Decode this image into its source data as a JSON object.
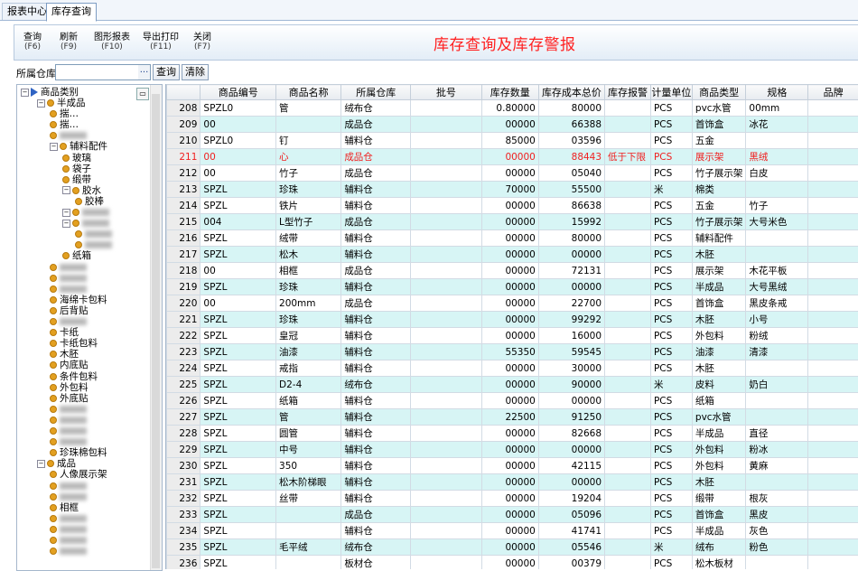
{
  "tabs": [
    "报表中心",
    "库存查询"
  ],
  "toolbar": {
    "buttons": [
      {
        "label": "查询",
        "key": "(F6)"
      },
      {
        "label": "刷新",
        "key": "(F9)"
      },
      {
        "label": "图形报表",
        "key": "(F10)"
      },
      {
        "label": "导出打印",
        "key": "(F11)"
      },
      {
        "label": "关闭",
        "key": "(F7)"
      }
    ],
    "banner": "库存查询及库存警报"
  },
  "filter": {
    "label": "所属仓库:",
    "value": "",
    "dots": "...",
    "query": "查询",
    "clear": "清除"
  },
  "tree": {
    "root": "商品类别",
    "items": [
      {
        "t": "半成品",
        "lv": 1,
        "k": "m"
      },
      {
        "t": "揣…",
        "lv": 2,
        "k": "n"
      },
      {
        "t": "揣…",
        "lv": 2,
        "k": "n"
      },
      {
        "t": "",
        "lv": 2,
        "k": "n"
      },
      {
        "t": "辅料配件",
        "lv": 2,
        "k": "m"
      },
      {
        "t": "玻璃",
        "lv": 3,
        "k": "n"
      },
      {
        "t": "袋子",
        "lv": 3,
        "k": "n"
      },
      {
        "t": "缎带",
        "lv": 3,
        "k": "n"
      },
      {
        "t": "胶水",
        "lv": 3,
        "k": "m"
      },
      {
        "t": "胶棒",
        "lv": 4,
        "k": "n"
      },
      {
        "t": "",
        "lv": 3,
        "k": "m"
      },
      {
        "t": "",
        "lv": 3,
        "k": "m"
      },
      {
        "t": "",
        "lv": 4,
        "k": "n"
      },
      {
        "t": "",
        "lv": 4,
        "k": "n"
      },
      {
        "t": "纸箱",
        "lv": 3,
        "k": "n"
      },
      {
        "t": "",
        "lv": 2,
        "k": "n"
      },
      {
        "t": "",
        "lv": 2,
        "k": "n"
      },
      {
        "t": "",
        "lv": 2,
        "k": "n"
      },
      {
        "t": "海绵卡包料",
        "lv": 2,
        "k": "n"
      },
      {
        "t": "后背贴",
        "lv": 2,
        "k": "n"
      },
      {
        "t": "",
        "lv": 2,
        "k": "n"
      },
      {
        "t": "卡纸",
        "lv": 2,
        "k": "n"
      },
      {
        "t": "卡纸包料",
        "lv": 2,
        "k": "n"
      },
      {
        "t": "木胚",
        "lv": 2,
        "k": "n"
      },
      {
        "t": "内底贴",
        "lv": 2,
        "k": "n"
      },
      {
        "t": "条件包料",
        "lv": 2,
        "k": "n"
      },
      {
        "t": "外包料",
        "lv": 2,
        "k": "n"
      },
      {
        "t": "外底贴",
        "lv": 2,
        "k": "n"
      },
      {
        "t": "",
        "lv": 2,
        "k": "n"
      },
      {
        "t": "",
        "lv": 2,
        "k": "n"
      },
      {
        "t": "",
        "lv": 2,
        "k": "n"
      },
      {
        "t": "",
        "lv": 2,
        "k": "n"
      },
      {
        "t": "珍珠棉包料",
        "lv": 2,
        "k": "n"
      },
      {
        "t": "成品",
        "lv": 1,
        "k": "m"
      },
      {
        "t": "人像展示架",
        "lv": 2,
        "k": "n"
      },
      {
        "t": "",
        "lv": 2,
        "k": "n"
      },
      {
        "t": "",
        "lv": 2,
        "k": "n"
      },
      {
        "t": "相框",
        "lv": 2,
        "k": "n"
      },
      {
        "t": "",
        "lv": 2,
        "k": "n"
      },
      {
        "t": "",
        "lv": 2,
        "k": "n"
      },
      {
        "t": "",
        "lv": 2,
        "k": "n"
      },
      {
        "t": "",
        "lv": 2,
        "k": "n"
      }
    ]
  },
  "grid": {
    "headers": [
      "",
      "商品编号",
      "商品名称",
      "所属仓库",
      "批号",
      "库存数量",
      "库存成本总价",
      "库存报警",
      "计量单位",
      "商品类型",
      "规格",
      "品牌"
    ],
    "rows": [
      {
        "n": "208",
        "c": "SPZL0",
        "nm": "管",
        "w": "绒布仓",
        "q": "0.80000",
        "cost": "80000",
        "a": "",
        "u": "PCS",
        "t": "pvc水管",
        "s": "00mm"
      },
      {
        "n": "209",
        "c": "00",
        "nm": "",
        "w": "成品仓",
        "q": "00000",
        "cost": "66388",
        "a": "",
        "u": "PCS",
        "t": "首饰盒",
        "s": "冰花"
      },
      {
        "n": "210",
        "c": "SPZL0",
        "nm": "钉",
        "w": "辅料仓",
        "q": "85000",
        "cost": "03596",
        "a": "",
        "u": "PCS",
        "t": "五金",
        "s": ""
      },
      {
        "n": "211",
        "c": "00",
        "nm": "心",
        "w": "成品仓",
        "q": "00000",
        "cost": "88443",
        "a": "低于下限",
        "u": "PCS",
        "t": "展示架",
        "s": "黑绒"
      },
      {
        "n": "212",
        "c": "00",
        "nm": "竹子",
        "w": "成品仓",
        "q": "00000",
        "cost": "05040",
        "a": "",
        "u": "PCS",
        "t": "竹子展示架",
        "s": "白皮"
      },
      {
        "n": "213",
        "c": "SPZL",
        "nm": "珍珠",
        "w": "辅料仓",
        "q": "70000",
        "cost": "55500",
        "a": "",
        "u": "米",
        "t": "棉类",
        "s": ""
      },
      {
        "n": "214",
        "c": "SPZL",
        "nm": "铁片",
        "w": "辅料仓",
        "q": "00000",
        "cost": "86638",
        "a": "",
        "u": "PCS",
        "t": "五金",
        "s": "竹子"
      },
      {
        "n": "215",
        "c": "004",
        "nm": "L型竹子",
        "w": "成品仓",
        "q": "00000",
        "cost": "15992",
        "a": "",
        "u": "PCS",
        "t": "竹子展示架",
        "s": "大号米色"
      },
      {
        "n": "216",
        "c": "SPZL",
        "nm": "绒带",
        "w": "辅料仓",
        "q": "00000",
        "cost": "80000",
        "a": "",
        "u": "PCS",
        "t": "辅料配件",
        "s": ""
      },
      {
        "n": "217",
        "c": "SPZL",
        "nm": "松木",
        "w": "辅料仓",
        "q": "00000",
        "cost": "00000",
        "a": "",
        "u": "PCS",
        "t": "木胚",
        "s": ""
      },
      {
        "n": "218",
        "c": "00",
        "nm": "相框",
        "w": "成品仓",
        "q": "00000",
        "cost": "72131",
        "a": "",
        "u": "PCS",
        "t": "展示架",
        "s": "木花平板"
      },
      {
        "n": "219",
        "c": "SPZL",
        "nm": "珍珠",
        "w": "辅料仓",
        "q": "00000",
        "cost": "00000",
        "a": "",
        "u": "PCS",
        "t": "半成品",
        "s": "大号黑绒"
      },
      {
        "n": "220",
        "c": "00",
        "nm": "200mm",
        "w": "成品仓",
        "q": "00000",
        "cost": "22700",
        "a": "",
        "u": "PCS",
        "t": "首饰盒",
        "s": "黑皮条戒"
      },
      {
        "n": "221",
        "c": "SPZL",
        "nm": "珍珠",
        "w": "辅料仓",
        "q": "00000",
        "cost": "99292",
        "a": "",
        "u": "PCS",
        "t": "木胚",
        "s": "小号"
      },
      {
        "n": "222",
        "c": "SPZL",
        "nm": "皇冠",
        "w": "辅料仓",
        "q": "00000",
        "cost": "16000",
        "a": "",
        "u": "PCS",
        "t": "外包料",
        "s": "粉绒"
      },
      {
        "n": "223",
        "c": "SPZL",
        "nm": "油漆",
        "w": "辅料仓",
        "q": "55350",
        "cost": "59545",
        "a": "",
        "u": "PCS",
        "t": "油漆",
        "s": "清漆"
      },
      {
        "n": "224",
        "c": "SPZL",
        "nm": "戒指",
        "w": "辅料仓",
        "q": "00000",
        "cost": "30000",
        "a": "",
        "u": "PCS",
        "t": "木胚",
        "s": ""
      },
      {
        "n": "225",
        "c": "SPZL",
        "nm": "D2-4",
        "w": "绒布仓",
        "q": "00000",
        "cost": "90000",
        "a": "",
        "u": "米",
        "t": "皮料",
        "s": "奶白"
      },
      {
        "n": "226",
        "c": "SPZL",
        "nm": "纸箱",
        "w": "辅料仓",
        "q": "00000",
        "cost": "00000",
        "a": "",
        "u": "PCS",
        "t": "纸箱",
        "s": ""
      },
      {
        "n": "227",
        "c": "SPZL",
        "nm": "管",
        "w": "辅料仓",
        "q": "22500",
        "cost": "91250",
        "a": "",
        "u": "PCS",
        "t": "pvc水管",
        "s": ""
      },
      {
        "n": "228",
        "c": "SPZL",
        "nm": "圆管",
        "w": "辅料仓",
        "q": "00000",
        "cost": "82668",
        "a": "",
        "u": "PCS",
        "t": "半成品",
        "s": "直径"
      },
      {
        "n": "229",
        "c": "SPZL",
        "nm": "中号",
        "w": "辅料仓",
        "q": "00000",
        "cost": "00000",
        "a": "",
        "u": "PCS",
        "t": "外包料",
        "s": "粉冰"
      },
      {
        "n": "230",
        "c": "SPZL",
        "nm": "350",
        "w": "辅料仓",
        "q": "00000",
        "cost": "42115",
        "a": "",
        "u": "PCS",
        "t": "外包料",
        "s": "黄麻"
      },
      {
        "n": "231",
        "c": "SPZL",
        "nm": "松木阶梯眼",
        "w": "辅料仓",
        "q": "00000",
        "cost": "00000",
        "a": "",
        "u": "PCS",
        "t": "木胚",
        "s": ""
      },
      {
        "n": "232",
        "c": "SPZL",
        "nm": "丝带",
        "w": "辅料仓",
        "q": "00000",
        "cost": "19204",
        "a": "",
        "u": "PCS",
        "t": "缎带",
        "s": "根灰"
      },
      {
        "n": "233",
        "c": "SPZL",
        "nm": "",
        "w": "成品仓",
        "q": "00000",
        "cost": "05096",
        "a": "",
        "u": "PCS",
        "t": "首饰盒",
        "s": "黑皮"
      },
      {
        "n": "234",
        "c": "SPZL",
        "nm": "",
        "w": "辅料仓",
        "q": "00000",
        "cost": "41741",
        "a": "",
        "u": "PCS",
        "t": "半成品",
        "s": "灰色"
      },
      {
        "n": "235",
        "c": "SPZL",
        "nm": "毛平绒",
        "w": "绒布仓",
        "q": "00000",
        "cost": "05546",
        "a": "",
        "u": "米",
        "t": "绒布",
        "s": "粉色"
      },
      {
        "n": "236",
        "c": "SPZL",
        "nm": "",
        "w": "板材仓",
        "q": "00000",
        "cost": "00379",
        "a": "",
        "u": "PCS",
        "t": "松木板材",
        "s": ""
      }
    ]
  },
  "colors": {
    "banner": "#ff2020",
    "alt_row": "#d7f5f5",
    "alert": "#f02020"
  }
}
